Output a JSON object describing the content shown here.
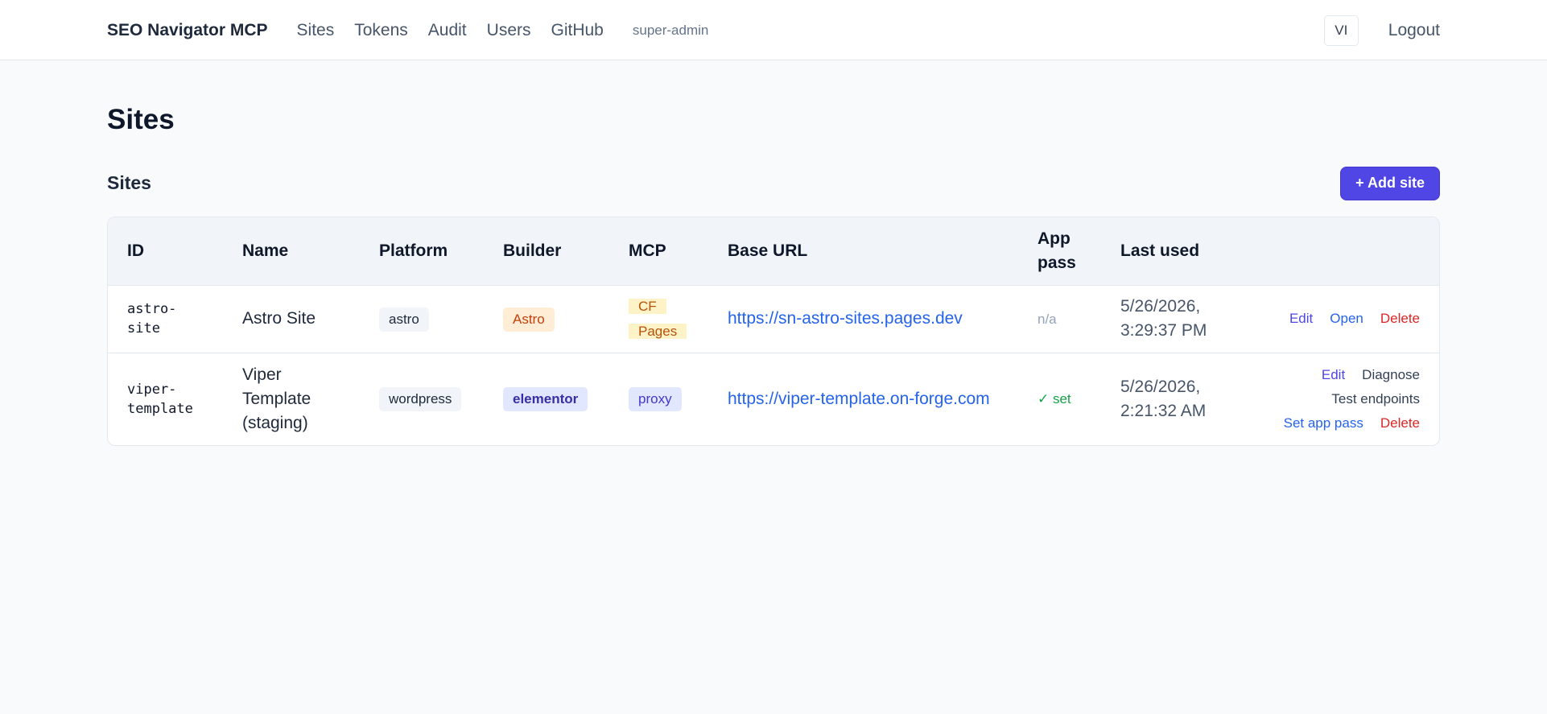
{
  "header": {
    "brand": "SEO Navigator MCP",
    "nav": [
      "Sites",
      "Tokens",
      "Audit",
      "Users",
      "GitHub"
    ],
    "role": "super-admin",
    "lang": "VI",
    "logout": "Logout"
  },
  "page_title": "Sites",
  "section": {
    "title": "Sites",
    "add_button": "+ Add site"
  },
  "table": {
    "columns": {
      "id": "ID",
      "name": "Name",
      "platform": "Platform",
      "builder": "Builder",
      "mcp": "MCP",
      "base_url": "Base URL",
      "app_pass": "App pass",
      "last_used": "Last used"
    },
    "rows": [
      {
        "id": "astro-site",
        "name": "Astro Site",
        "platform": "astro",
        "builder": "Astro",
        "mcp": "CF Pages",
        "base_url": "https://sn-astro-sites.pages.dev",
        "app_pass": "n/a",
        "last_used": "5/26/2026, 3:29:37 PM",
        "actions": {
          "edit": "Edit",
          "open": "Open",
          "delete": "Delete"
        }
      },
      {
        "id": "viper-template",
        "name": "Viper Template (staging)",
        "platform": "wordpress",
        "builder": "elementor",
        "mcp": "proxy",
        "base_url": "https://viper-template.on-forge.com",
        "app_pass": "✓ set",
        "last_used": "5/26/2026, 2:21:32 AM",
        "actions": {
          "edit": "Edit",
          "diagnose": "Diagnose",
          "test_endpoints": "Test endpoints",
          "set_app_pass": "Set app pass",
          "delete": "Delete"
        }
      }
    ]
  },
  "colors": {
    "accent": "#4f46e5",
    "link": "#2563eb",
    "danger": "#dc2626",
    "success": "#16a34a"
  }
}
